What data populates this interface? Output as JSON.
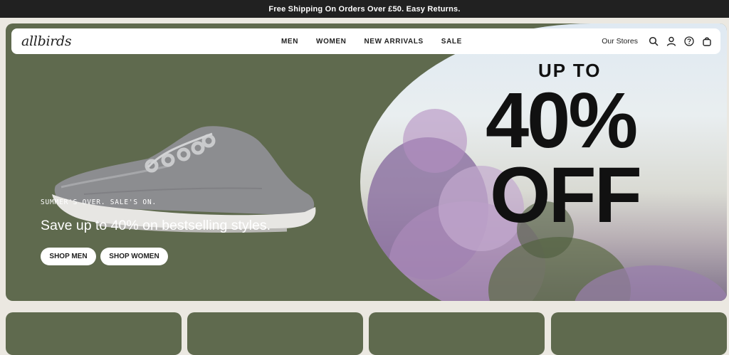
{
  "announcement": "Free Shipping On Orders Over £50. Easy Returns.",
  "logo": "allbirds",
  "nav": {
    "links": [
      "MEN",
      "WOMEN",
      "NEW ARRIVALS",
      "SALE"
    ],
    "stores": "Our Stores"
  },
  "hero": {
    "tagline": "SUMMER'S OVER. SALE'S ON.",
    "headline": "Save up to 40% on bestselling styles.",
    "shop_men": "SHOP MEN",
    "shop_women": "SHOP WOMEN",
    "promo_up_to": "UP TO",
    "promo_percent": "40%",
    "promo_off": "OFF"
  },
  "colors": {
    "hero_bg": "#5f6a4e",
    "announce_bg": "#212121",
    "page_bg": "#ebe8e1"
  },
  "icons": [
    "search-icon",
    "account-icon",
    "help-icon",
    "cart-icon"
  ]
}
